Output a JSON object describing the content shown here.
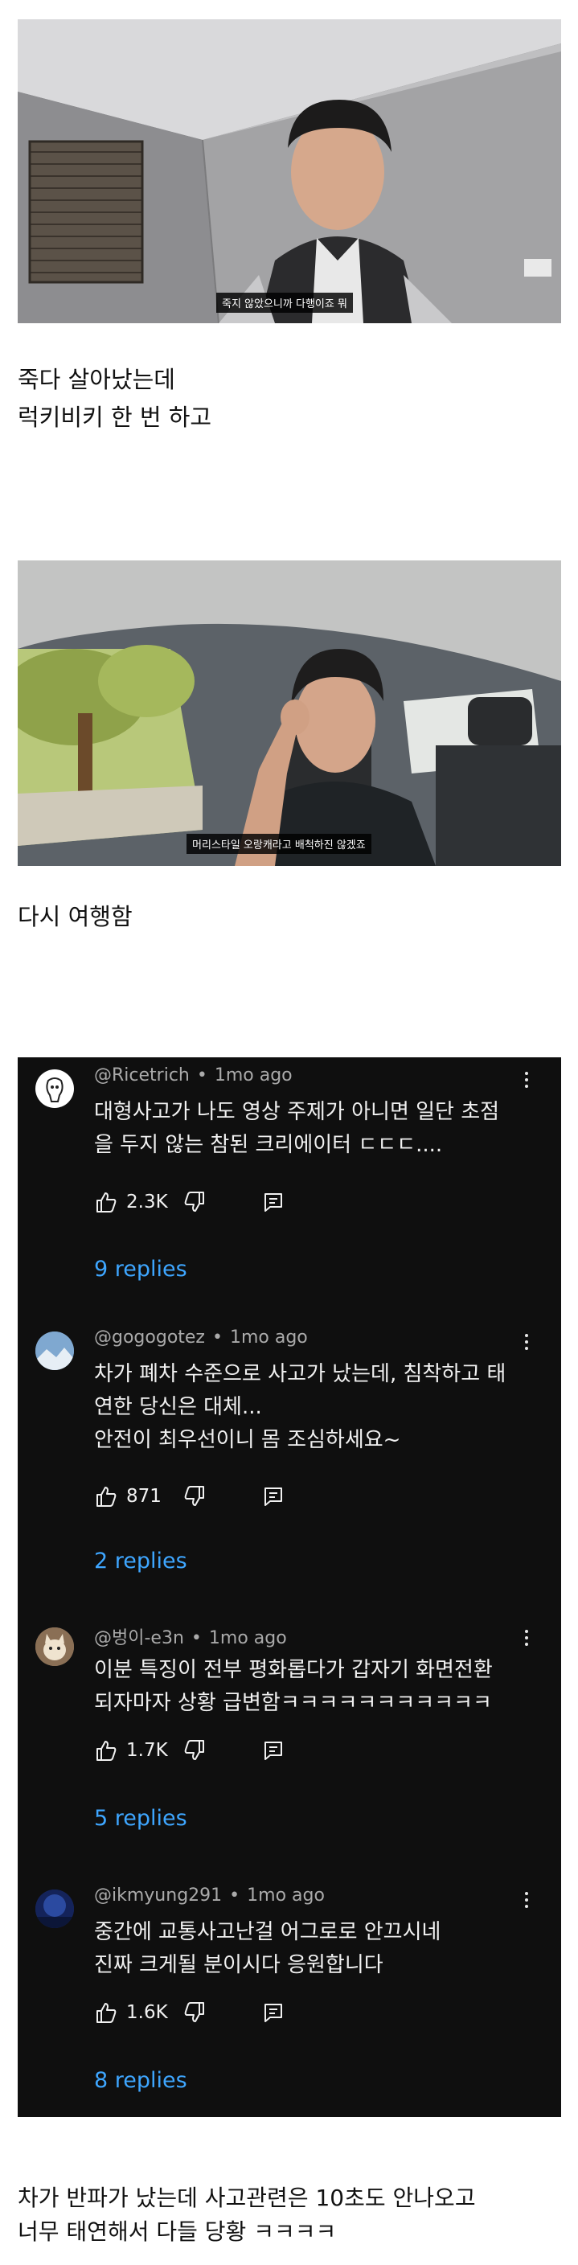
{
  "images": [
    {
      "subtitle": "죽지 않았으니까 다행이죠 뭐"
    },
    {
      "subtitle": "머리스타일 오랑캐라고 배척하진 않겠죠"
    }
  ],
  "captions": {
    "first_line1": " 죽다 살아났는데",
    "first_line2": "럭키비키 한 번 하고",
    "second": "다시 여행함",
    "final_line1": "차가 반파가 났는데 사고관련은 10초도 안나오고",
    "final_line2": "너무 태연해서 다들 당황 ㅋㅋㅋㅋ"
  },
  "comments": [
    {
      "handle": "@Ricetrich",
      "time": "1mo ago",
      "lines": [
        "대형사고가 나도 영상 주제가 아니면 일단 초점",
        "을 두지 않는 참된 크리에이터 ㄷㄷㄷ...."
      ],
      "likes": "2.3K",
      "replies": "9 replies"
    },
    {
      "handle": "@gogogotez",
      "time": "1mo ago",
      "lines": [
        "차가 폐차 수준으로 사고가 났는데, 침착하고 태",
        "연한 당신은 대체...",
        "안전이 최우선이니 몸 조심하세요~"
      ],
      "likes": "871",
      "replies": "2 replies"
    },
    {
      "handle": "@벙이-e3n",
      "time": "1mo ago",
      "lines": [
        "이분 특징이 전부 평화롭다가 갑자기 화면전환",
        "되자마자 상황 급변함ㅋㅋㅋㅋㅋㅋㅋㅋㅋㅋㅋ"
      ],
      "likes": "1.7K",
      "replies": "5 replies"
    },
    {
      "handle": "@ikmyung291",
      "time": "1mo ago",
      "lines": [
        "중간에 교통사고난걸 어그로로 안끄시네",
        "진짜 크게될 분이시다 응원합니다"
      ],
      "likes": "1.6K",
      "replies": "8 replies"
    }
  ],
  "colors": {
    "panel_bg": "#0f0f0f",
    "text": "#f1f1f1",
    "meta": "#aaaaaa",
    "link": "#3ea6ff"
  },
  "icons": [
    "thumbs-up-icon",
    "thumbs-down-icon",
    "reply-icon",
    "kebab-menu-icon"
  ]
}
